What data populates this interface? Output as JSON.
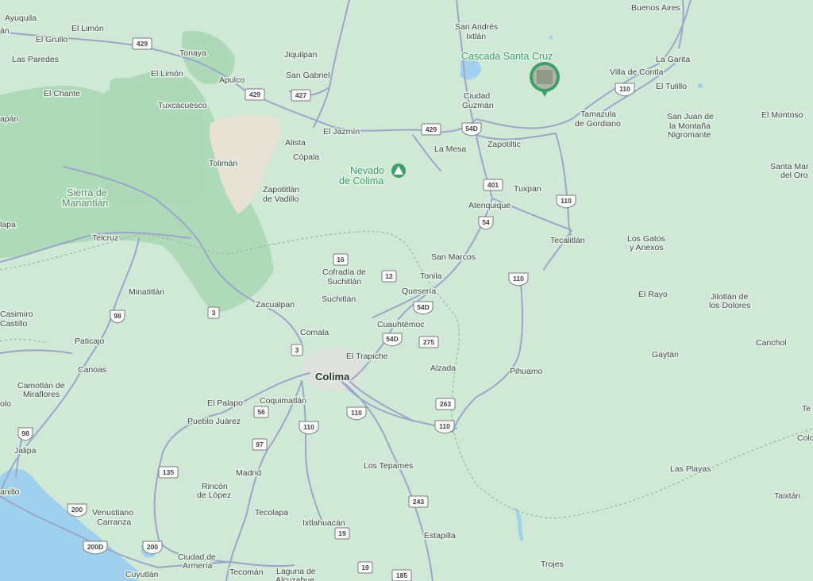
{
  "map": {
    "colors": {
      "land": "#cfe9d6",
      "forest": "#a9d8b5",
      "urban": "#e8e2d6",
      "water": "#9fd0ee",
      "road": "#9aa9c7",
      "highway": "#8a9ac0"
    },
    "places": [
      {
        "id": "ayuquila",
        "text": "Ayuquila"
      },
      {
        "id": "an",
        "text": "án"
      },
      {
        "id": "el-limon-1",
        "text": "El Limón"
      },
      {
        "id": "el-grullo",
        "text": "El Grullo"
      },
      {
        "id": "las-paredes",
        "text": "Las Paredes"
      },
      {
        "id": "tonaya",
        "text": "Tonaya"
      },
      {
        "id": "el-limon-2",
        "text": "El Limón"
      },
      {
        "id": "apulco",
        "text": "Apulco"
      },
      {
        "id": "el-chante",
        "text": "El Chante"
      },
      {
        "id": "tuxcacuesco",
        "text": "Tuxcacuesco"
      },
      {
        "id": "apan",
        "text": "apán"
      },
      {
        "id": "jiquilpan",
        "text": "Jiquilpan"
      },
      {
        "id": "san-gabriel",
        "text": "San Gabriel"
      },
      {
        "id": "san-andres-1",
        "text": "San Andrés"
      },
      {
        "id": "san-andres-2",
        "text": "Ixtlán"
      },
      {
        "id": "ciudad-guzman-1",
        "text": "Ciudad"
      },
      {
        "id": "ciudad-guzman-2",
        "text": "Guzmán"
      },
      {
        "id": "la-mesa",
        "text": "La Mesa"
      },
      {
        "id": "zapotiltic",
        "text": "Zapotiltic"
      },
      {
        "id": "el-jazmin",
        "text": "El Jazmín"
      },
      {
        "id": "alista",
        "text": "Alista"
      },
      {
        "id": "copala",
        "text": "Cópala"
      },
      {
        "id": "toliman",
        "text": "Tolimán"
      },
      {
        "id": "zapotitlan-1",
        "text": "Zapotitlán"
      },
      {
        "id": "zapotitlan-2",
        "text": "de Vadillo"
      },
      {
        "id": "tuxpan",
        "text": "Tuxpan"
      },
      {
        "id": "atenquique",
        "text": "Atenquique"
      },
      {
        "id": "tecalitlan",
        "text": "Tecalitlán"
      },
      {
        "id": "la-garita",
        "text": "La Garita"
      },
      {
        "id": "villa-contla",
        "text": "Villa de Contla"
      },
      {
        "id": "el-tulillo",
        "text": "El Tulillo"
      },
      {
        "id": "tamazula-1",
        "text": "Tamazula"
      },
      {
        "id": "tamazula-2",
        "text": "de Gordiano"
      },
      {
        "id": "san-juan-1",
        "text": "San Juan de"
      },
      {
        "id": "san-juan-2",
        "text": "la Montaña"
      },
      {
        "id": "san-juan-3",
        "text": "Nigromante"
      },
      {
        "id": "el-montoso",
        "text": "El Montoso"
      },
      {
        "id": "santa-mar-1",
        "text": "Santa Mar"
      },
      {
        "id": "santa-mar-2",
        "text": "del Oro"
      },
      {
        "id": "buenos-aires",
        "text": "Buenos Aires"
      },
      {
        "id": "los-gatos-1",
        "text": "Los Gatos"
      },
      {
        "id": "los-gatos-2",
        "text": "y Anexos"
      },
      {
        "id": "el-rayo",
        "text": "El Rayo"
      },
      {
        "id": "jilotlan-1",
        "text": "Jilotlán de"
      },
      {
        "id": "jilotlan-2",
        "text": "los Dolores"
      },
      {
        "id": "gaytan",
        "text": "Gaytán"
      },
      {
        "id": "canchol",
        "text": "Canchol"
      },
      {
        "id": "lapa",
        "text": "lapa"
      },
      {
        "id": "telcruz",
        "text": "Telcruz"
      },
      {
        "id": "minatitlan",
        "text": "Minatitlán"
      },
      {
        "id": "cofradia-1",
        "text": "Cofradía de"
      },
      {
        "id": "cofradia-2",
        "text": "Suchitlán"
      },
      {
        "id": "suchitlan",
        "text": "Suchitlán"
      },
      {
        "id": "zacualpan",
        "text": "Zacualpan"
      },
      {
        "id": "san-marcos",
        "text": "San Marcos"
      },
      {
        "id": "tonila",
        "text": "Tonila"
      },
      {
        "id": "queseria",
        "text": "Quesería"
      },
      {
        "id": "casimiro-1",
        "text": "Casimiro"
      },
      {
        "id": "casimiro-2",
        "text": "Castillo"
      },
      {
        "id": "paticajo",
        "text": "Paticajo"
      },
      {
        "id": "comala",
        "text": "Comala"
      },
      {
        "id": "cuauhtemoc",
        "text": "Cuauhtémoc"
      },
      {
        "id": "el-trapiche",
        "text": "El Trapiche"
      },
      {
        "id": "canoas",
        "text": "Canoas"
      },
      {
        "id": "alzada",
        "text": "Alzada"
      },
      {
        "id": "pihuamo",
        "text": "Pihuamo"
      },
      {
        "id": "camotlan-1",
        "text": "Camotlán de"
      },
      {
        "id": "camotlan-2",
        "text": "Miraflores"
      },
      {
        "id": "olo",
        "text": "olo"
      },
      {
        "id": "el-palapo",
        "text": "El Palapo"
      },
      {
        "id": "coquimatlan",
        "text": "Coquimatlán"
      },
      {
        "id": "pueblo-juarez",
        "text": "Pueblo Juárez"
      },
      {
        "id": "jalipa",
        "text": "Jalipa"
      },
      {
        "id": "los-tepames",
        "text": "Los Tepames"
      },
      {
        "id": "madrid",
        "text": "Madrid"
      },
      {
        "id": "rincon-1",
        "text": "Rincón"
      },
      {
        "id": "rincon-2",
        "text": "de López"
      },
      {
        "id": "anillo",
        "text": "anillo"
      },
      {
        "id": "venustiano-1",
        "text": "Venustiano"
      },
      {
        "id": "venustiano-2",
        "text": "Carranza"
      },
      {
        "id": "tecolapa",
        "text": "Tecolapa"
      },
      {
        "id": "ixtlahuacan",
        "text": "Ixtlahuacán"
      },
      {
        "id": "estapilla",
        "text": "Estapilla"
      },
      {
        "id": "trojes",
        "text": "Trojes"
      },
      {
        "id": "las-playas",
        "text": "Las Playas"
      },
      {
        "id": "taixtan",
        "text": "Taixtán"
      },
      {
        "id": "te",
        "text": "Te"
      },
      {
        "id": "colo",
        "text": "Colo"
      },
      {
        "id": "ciudad-armeria-1",
        "text": "Ciudad de"
      },
      {
        "id": "ciudad-armeria-2",
        "text": "Armería"
      },
      {
        "id": "cuyutlan",
        "text": "Cuyutlán"
      },
      {
        "id": "tecoman",
        "text": "Tecomán"
      },
      {
        "id": "laguna-1",
        "text": "Laguna de"
      },
      {
        "id": "laguna-2",
        "text": "Alcuzahue"
      }
    ],
    "city": {
      "text": "Colima"
    },
    "terrain": [
      {
        "id": "manantlan-1",
        "text": "Sierra de"
      },
      {
        "id": "manantlan-2",
        "text": "Manantlán"
      }
    ],
    "poi": [
      {
        "id": "cascada",
        "text": "Cascada Santa Cruz",
        "icon": "photo-pin-icon"
      },
      {
        "id": "nevado-1",
        "text": "Nevado",
        "icon": "mountain-peak-icon"
      },
      {
        "id": "nevado-2",
        "text": "de Colima"
      }
    ],
    "shields": [
      {
        "id": "s429a",
        "text": "429",
        "kind": "state"
      },
      {
        "id": "s429b",
        "text": "429",
        "kind": "state"
      },
      {
        "id": "s427",
        "text": "427",
        "kind": "state"
      },
      {
        "id": "s429c",
        "text": "429",
        "kind": "state"
      },
      {
        "id": "s54d1",
        "text": "54D",
        "kind": "federal"
      },
      {
        "id": "s401",
        "text": "401",
        "kind": "state"
      },
      {
        "id": "s54",
        "text": "54",
        "kind": "federal"
      },
      {
        "id": "s110a",
        "text": "110",
        "kind": "federal"
      },
      {
        "id": "s110b",
        "text": "110",
        "kind": "federal"
      },
      {
        "id": "s110c",
        "text": "110",
        "kind": "federal"
      },
      {
        "id": "s16",
        "text": "16",
        "kind": "state"
      },
      {
        "id": "s12",
        "text": "12",
        "kind": "state"
      },
      {
        "id": "s54d2",
        "text": "54D",
        "kind": "federal"
      },
      {
        "id": "s54d3",
        "text": "54D",
        "kind": "federal"
      },
      {
        "id": "s275",
        "text": "275",
        "kind": "state"
      },
      {
        "id": "s98a",
        "text": "98",
        "kind": "federal"
      },
      {
        "id": "s3a",
        "text": "3",
        "kind": "state"
      },
      {
        "id": "s3b",
        "text": "3",
        "kind": "state"
      },
      {
        "id": "s263",
        "text": "263",
        "kind": "state"
      },
      {
        "id": "s110d",
        "text": "110",
        "kind": "federal"
      },
      {
        "id": "s110e",
        "text": "110",
        "kind": "federal"
      },
      {
        "id": "s110f",
        "text": "110",
        "kind": "federal"
      },
      {
        "id": "s56",
        "text": "56",
        "kind": "state"
      },
      {
        "id": "s97",
        "text": "97",
        "kind": "state"
      },
      {
        "id": "s98b",
        "text": "98",
        "kind": "federal"
      },
      {
        "id": "s135",
        "text": "135",
        "kind": "state"
      },
      {
        "id": "s243",
        "text": "243",
        "kind": "state"
      },
      {
        "id": "s200a",
        "text": "200",
        "kind": "federal"
      },
      {
        "id": "s200d",
        "text": "200D",
        "kind": "federal"
      },
      {
        "id": "s200b",
        "text": "200",
        "kind": "federal"
      },
      {
        "id": "s19a",
        "text": "19",
        "kind": "state"
      },
      {
        "id": "s19b",
        "text": "19",
        "kind": "state"
      },
      {
        "id": "s185",
        "text": "185",
        "kind": "state"
      }
    ]
  }
}
